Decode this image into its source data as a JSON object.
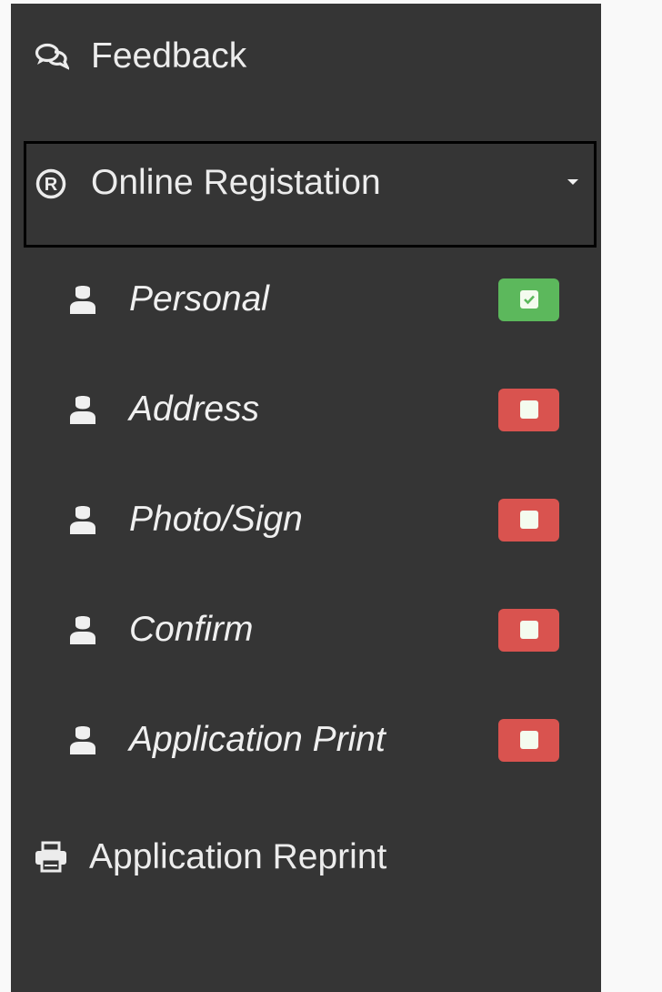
{
  "sidebar": {
    "feedback": {
      "label": "Feedback",
      "icon": "comments-icon"
    },
    "registration": {
      "label": "Online Registation",
      "icon": "registered-icon",
      "expanded": true
    },
    "sub_items": [
      {
        "label": "Personal",
        "icon": "user-icon",
        "status": "complete",
        "status_color": "#5cb85c"
      },
      {
        "label": "Address",
        "icon": "user-icon",
        "status": "incomplete",
        "status_color": "#d9534f"
      },
      {
        "label": "Photo/Sign",
        "icon": "user-icon",
        "status": "incomplete",
        "status_color": "#d9534f"
      },
      {
        "label": "Confirm",
        "icon": "user-icon",
        "status": "incomplete",
        "status_color": "#d9534f"
      },
      {
        "label": "Application Print",
        "icon": "user-icon",
        "status": "incomplete",
        "status_color": "#d9534f"
      }
    ],
    "reprint": {
      "label": "Application Reprint",
      "icon": "print-icon"
    }
  },
  "colors": {
    "sidebar_bg": "#353535",
    "page_bg": "#f9f9f9",
    "complete": "#5cb85c",
    "incomplete": "#d9534f"
  }
}
